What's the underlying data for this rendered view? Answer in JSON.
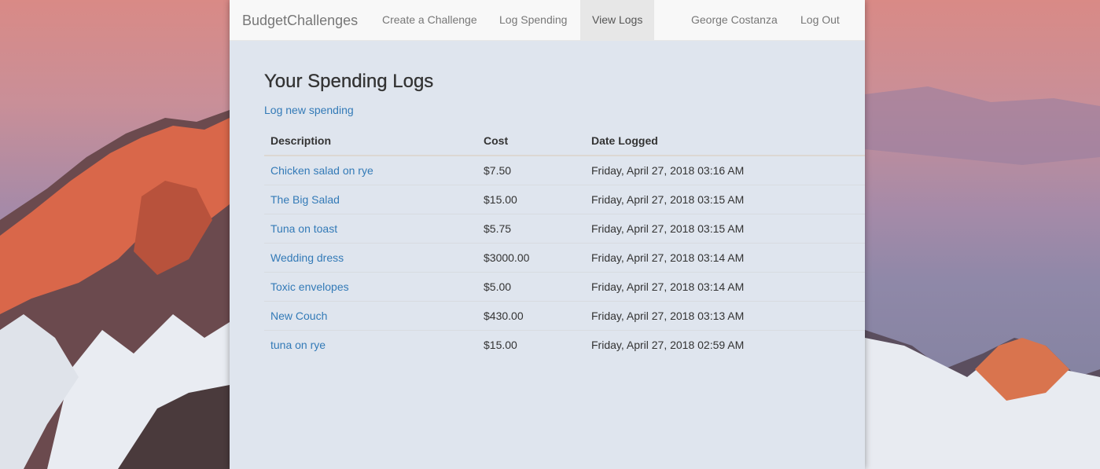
{
  "navbar": {
    "brand": "BudgetChallenges",
    "links": [
      {
        "label": "Create a Challenge"
      },
      {
        "label": "Log Spending"
      },
      {
        "label": "View Logs"
      }
    ],
    "user": "George Costanza",
    "logout": "Log Out"
  },
  "main": {
    "title": "Your Spending Logs",
    "new_link": "Log new spending",
    "columns": [
      "Description",
      "Cost",
      "Date Logged"
    ],
    "rows": [
      {
        "description": "Chicken salad on rye",
        "cost": "$7.50",
        "date": "Friday, April 27, 2018 03:16 AM"
      },
      {
        "description": "The Big Salad",
        "cost": "$15.00",
        "date": "Friday, April 27, 2018 03:15 AM"
      },
      {
        "description": "Tuna on toast",
        "cost": "$5.75",
        "date": "Friday, April 27, 2018 03:15 AM"
      },
      {
        "description": "Wedding dress",
        "cost": "$3000.00",
        "date": "Friday, April 27, 2018 03:14 AM"
      },
      {
        "description": "Toxic envelopes",
        "cost": "$5.00",
        "date": "Friday, April 27, 2018 03:14 AM"
      },
      {
        "description": "New Couch",
        "cost": "$430.00",
        "date": "Friday, April 27, 2018 03:13 AM"
      },
      {
        "description": "tuna on rye",
        "cost": "$15.00",
        "date": "Friday, April 27, 2018 02:59 AM"
      }
    ]
  },
  "colors": {
    "link": "#337ab7",
    "navbar_bg": "#f8f8f8",
    "page_bg": "#dfe5ee",
    "active_tab_bg": "#e7e7e7"
  }
}
